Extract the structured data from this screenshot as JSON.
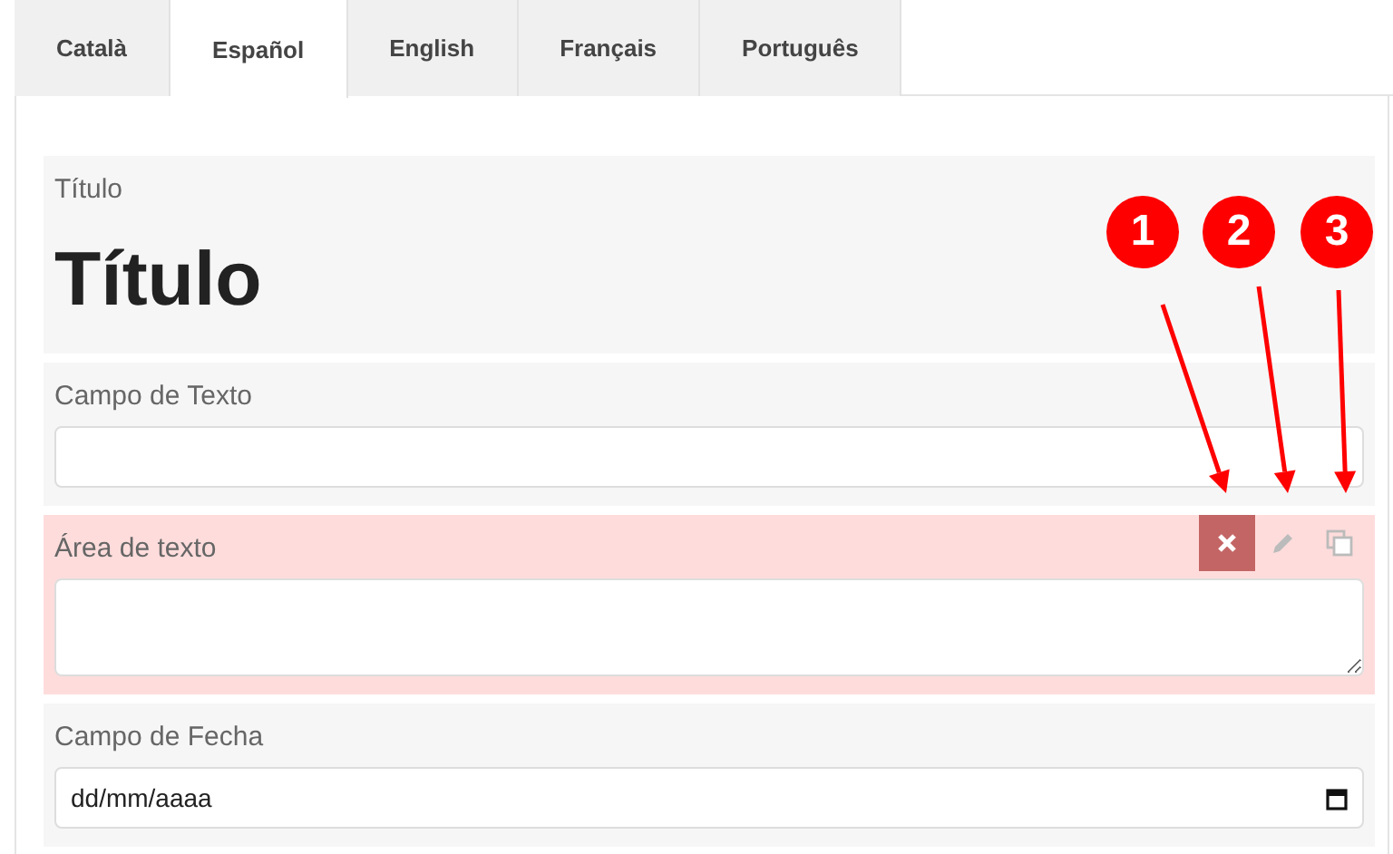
{
  "tabs": [
    {
      "label": "Català",
      "selected": false
    },
    {
      "label": "Español",
      "selected": true
    },
    {
      "label": "English",
      "selected": false
    },
    {
      "label": "Français",
      "selected": false
    },
    {
      "label": "Português",
      "selected": false
    }
  ],
  "fields": [
    {
      "kind": "heading",
      "label": "Título",
      "value": "Título",
      "highlighted": false
    },
    {
      "kind": "text",
      "label": "Campo de Texto",
      "highlighted": false
    },
    {
      "kind": "textarea",
      "label": "Área de texto",
      "highlighted": true
    },
    {
      "kind": "date",
      "label": "Campo de Fecha",
      "placeholder": "dd/mm/aaaa",
      "highlighted": false
    }
  ],
  "annotations": [
    {
      "label": "1"
    },
    {
      "label": "2"
    },
    {
      "label": "3"
    }
  ]
}
